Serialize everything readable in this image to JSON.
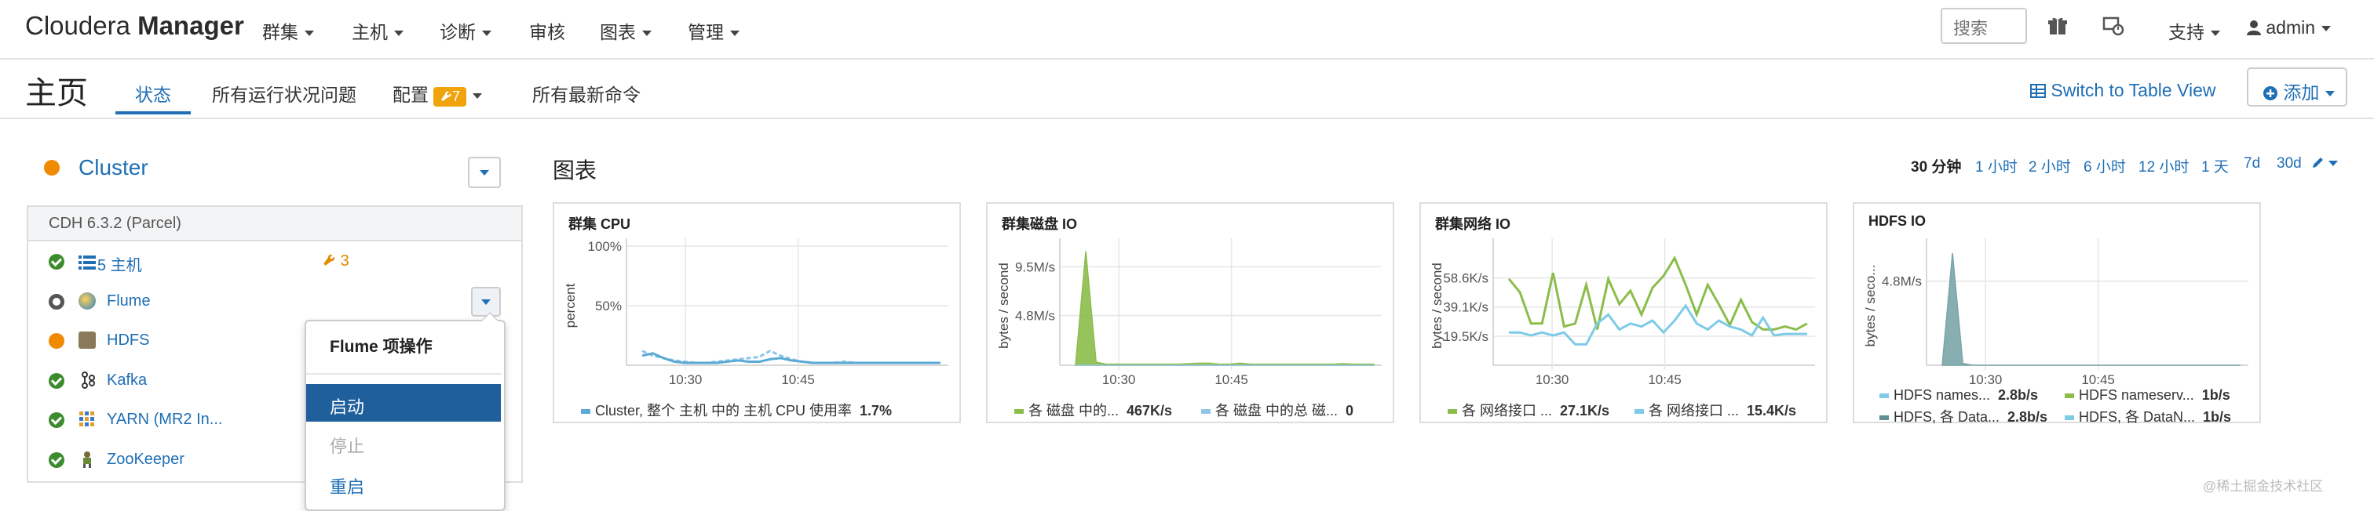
{
  "brand": {
    "name_light": "Cloudera",
    "name_bold": "Manager"
  },
  "nav": [
    "群集",
    "主机",
    "诊断",
    "审核",
    "图表",
    "管理"
  ],
  "nav_caret": [
    true,
    true,
    true,
    false,
    true,
    true
  ],
  "search": {
    "placeholder": "搜索"
  },
  "support_label": "支持",
  "user_label": "admin",
  "page": {
    "title": "主页",
    "tabs": [
      "状态",
      "所有运行状况问题",
      "配置",
      "所有最新命令"
    ],
    "config_badge": "7",
    "switch_view": "Switch to Table View",
    "add_label": "添加"
  },
  "cluster": {
    "name": "Cluster",
    "version": "CDH 6.3.2 (Parcel)",
    "hosts_label": "5 主机",
    "hosts_issues": "3",
    "services": [
      {
        "name": "Flume",
        "status": "stopped",
        "icon": "flume-icon"
      },
      {
        "name": "HDFS",
        "status": "warning",
        "icon": "hdfs-icon"
      },
      {
        "name": "Kafka",
        "status": "ok",
        "icon": "kafka-icon"
      },
      {
        "name": "YARN (MR2 In...",
        "status": "ok",
        "icon": "yarn-icon"
      },
      {
        "name": "ZooKeeper",
        "status": "ok",
        "icon": "zookeeper-icon"
      }
    ]
  },
  "flume_menu": {
    "header": "Flume 项操作",
    "items": [
      {
        "label": "启动",
        "state": "highlighted"
      },
      {
        "label": "停止",
        "state": "disabled"
      },
      {
        "label": "重启",
        "state": "normal"
      }
    ]
  },
  "charts_section": {
    "title": "图表",
    "ranges": [
      "30 分钟",
      "1 小时",
      "2 小时",
      "6 小时",
      "12 小时",
      "1 天",
      "7d",
      "30d"
    ],
    "active_range": "30 分钟"
  },
  "chart_data": [
    {
      "type": "line",
      "title": "群集 CPU",
      "ylabel": "percent",
      "yticks": [
        "100%",
        "50%"
      ],
      "xticks": [
        "10:30",
        "10:45"
      ],
      "ylim": [
        0,
        100
      ],
      "x": [
        0,
        1,
        2,
        3,
        4,
        5,
        6,
        7,
        8,
        9,
        10,
        11,
        12,
        13,
        14,
        15,
        16,
        17,
        18,
        19,
        20,
        21,
        22,
        23,
        24,
        25,
        26,
        27,
        28
      ],
      "series": [
        {
          "values": [
            12,
            8,
            6,
            4,
            3,
            2,
            2,
            3,
            4,
            5,
            6,
            7,
            12,
            8,
            5,
            3,
            2,
            2,
            2,
            3,
            2,
            2,
            2,
            2,
            2,
            2,
            2,
            2,
            2
          ],
          "color": "#8fc6e6"
        },
        {
          "values": [
            8,
            10,
            6,
            3,
            2,
            2,
            2,
            2,
            3,
            4,
            3,
            3,
            5,
            6,
            4,
            3,
            2,
            2,
            2,
            2,
            2,
            2,
            2,
            2,
            2,
            2,
            2,
            2,
            2
          ],
          "color": "#5aa9d6"
        }
      ],
      "legend": [
        {
          "name": "Cluster, 整个 主机 中的 主机 CPU 使用率",
          "value": "1.7%",
          "color": "#5aa9d6"
        }
      ]
    },
    {
      "type": "area",
      "title": "群集磁盘 IO",
      "ylabel": "bytes / second",
      "yticks": [
        "9.5M/s",
        "4.8M/s"
      ],
      "xticks": [
        "10:30",
        "10:45"
      ],
      "ylim": [
        0,
        11.5
      ],
      "x": [
        0,
        1,
        2,
        3,
        4,
        5,
        6,
        7,
        8,
        9,
        10,
        11,
        12,
        13,
        14,
        15,
        16,
        17,
        18,
        19,
        20,
        21,
        22,
        23,
        24,
        25,
        26,
        27,
        28,
        29
      ],
      "series": [
        {
          "values": [
            0,
            11,
            0.3,
            0.1,
            0.1,
            0.1,
            0.1,
            0.1,
            0.1,
            0.1,
            0.1,
            0.15,
            0.2,
            0.2,
            0.1,
            0.1,
            0.2,
            0.1,
            0.1,
            0.1,
            0.1,
            0.1,
            0.1,
            0.1,
            0.1,
            0.1,
            0.15,
            0.1,
            0.1,
            0.1
          ],
          "color": "#8cbd4b"
        },
        {
          "values": [
            0,
            0,
            0,
            0,
            0,
            0,
            0,
            0,
            0,
            0,
            0,
            0,
            0,
            0,
            0,
            0,
            0,
            0,
            0,
            0,
            0,
            0,
            0,
            0,
            0,
            0,
            0,
            0,
            0,
            0
          ],
          "color": "#8fc6e6"
        }
      ],
      "legend": [
        {
          "name": "各 磁盘 中的...",
          "value": "467K/s",
          "color": "#8cbd4b"
        },
        {
          "name": "各 磁盘 中的总 磁...",
          "value": "0",
          "color": "#8fc6e6"
        }
      ]
    },
    {
      "type": "line",
      "title": "群集网络 IO",
      "ylabel": "bytes / second",
      "yticks": [
        "58.6K/s",
        "39.1K/s",
        "19.5K/s"
      ],
      "xticks": [
        "10:30",
        "10:45"
      ],
      "ylim": [
        0,
        80
      ],
      "x": [
        0,
        1,
        2,
        3,
        4,
        5,
        6,
        7,
        8,
        9,
        10,
        11,
        12,
        13,
        14,
        15,
        16,
        17,
        18,
        19,
        20,
        21,
        22,
        23,
        24,
        25,
        26,
        27
      ],
      "series": [
        {
          "values": [
            58,
            49,
            28,
            28,
            62,
            26,
            28,
            54,
            24,
            58,
            41,
            50,
            34,
            52,
            60,
            72,
            54,
            34,
            54,
            41,
            27,
            44,
            29,
            24,
            24,
            26,
            24,
            28
          ],
          "color": "#8cbd4b"
        },
        {
          "values": [
            22,
            22,
            20,
            22,
            20,
            22,
            14,
            14,
            28,
            34,
            24,
            28,
            26,
            30,
            22,
            30,
            40,
            28,
            24,
            30,
            26,
            24,
            20,
            32,
            20,
            21,
            21,
            21
          ],
          "color": "#7ecbe8"
        }
      ],
      "legend": [
        {
          "name": "各 网络接口 ...",
          "value": "27.1K/s",
          "color": "#8cbd4b"
        },
        {
          "name": "各 网络接口 ...",
          "value": "15.4K/s",
          "color": "#7ecbe8"
        }
      ]
    },
    {
      "type": "area",
      "title": "HDFS IO",
      "ylabel": "bytes / seco...",
      "yticks": [
        "4.8M/s"
      ],
      "xticks": [
        "10:30",
        "10:45"
      ],
      "ylim": [
        0,
        6.8
      ],
      "x": [
        0,
        1,
        2,
        3,
        4,
        5,
        6,
        7,
        8,
        9,
        10,
        11,
        12,
        13,
        14,
        15,
        16,
        17,
        18,
        19,
        20,
        21,
        22,
        23,
        24,
        25,
        26,
        27,
        28,
        29
      ],
      "series": [
        {
          "values": [
            0,
            6.4,
            0.1,
            0,
            0,
            0,
            0,
            0,
            0,
            0,
            0,
            0,
            0,
            0,
            0,
            0,
            0,
            0,
            0,
            0,
            0,
            0,
            0,
            0,
            0,
            0,
            0,
            0,
            0,
            0
          ],
          "color": "#7aa5a7"
        }
      ],
      "legend": [
        {
          "name": "HDFS names...",
          "value": "2.8b/s",
          "color": "#7ecbe8"
        },
        {
          "name": "HDFS nameserv...",
          "value": "1b/s",
          "color": "#8cbd4b"
        },
        {
          "name": "HDFS, 各 Data...",
          "value": "2.8b/s",
          "color": "#5f8f93"
        },
        {
          "name": "HDFS, 各 DataN...",
          "value": "1b/s",
          "color": "#7ecbe8"
        }
      ]
    }
  ],
  "watermark": "@稀土掘金技术社区"
}
